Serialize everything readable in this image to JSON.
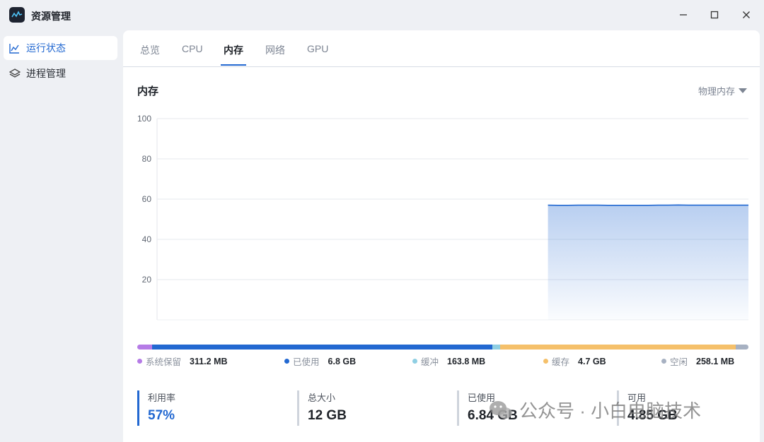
{
  "window": {
    "title": "资源管理"
  },
  "sidebar": {
    "items": [
      {
        "label": "运行状态",
        "icon": "line-chart-icon",
        "active": true
      },
      {
        "label": "进程管理",
        "icon": "layers-icon",
        "active": false
      }
    ]
  },
  "tabs": [
    {
      "label": "总览",
      "active": false
    },
    {
      "label": "CPU",
      "active": false
    },
    {
      "label": "内存",
      "active": true
    },
    {
      "label": "网络",
      "active": false
    },
    {
      "label": "GPU",
      "active": false
    }
  ],
  "section": {
    "title": "内存",
    "dropdown": "物理内存"
  },
  "chart_data": {
    "type": "area",
    "y_ticks": [
      "100",
      "80",
      "60",
      "40",
      "20"
    ],
    "ylim": [
      0,
      100
    ],
    "grid": true,
    "x": [
      0,
      1,
      2,
      3,
      4,
      5,
      6,
      7,
      8,
      9,
      10,
      11,
      12,
      13,
      14,
      15,
      16,
      17,
      18,
      19,
      20,
      21,
      22,
      23,
      24,
      25,
      26,
      27,
      28,
      29,
      30,
      31,
      32,
      33,
      34,
      35,
      36,
      37,
      38,
      39,
      40,
      41,
      42,
      43,
      44,
      45,
      46,
      47,
      48,
      49,
      50,
      51,
      52,
      53,
      54,
      55,
      56,
      57,
      58,
      59
    ],
    "values": [
      null,
      null,
      null,
      null,
      null,
      null,
      null,
      null,
      null,
      null,
      null,
      null,
      null,
      null,
      null,
      null,
      null,
      null,
      null,
      null,
      null,
      null,
      null,
      null,
      null,
      null,
      null,
      null,
      null,
      null,
      null,
      null,
      null,
      null,
      null,
      null,
      null,
      null,
      null,
      57.0,
      56.9,
      56.9,
      57.0,
      57.0,
      57.0,
      56.9,
      56.9,
      56.9,
      56.9,
      56.9,
      57.0,
      57.0,
      57.1,
      57.0,
      57.0,
      57.0,
      57.0,
      57.0,
      57.0,
      57.0
    ],
    "color": "#2268d1"
  },
  "memory_bar": [
    {
      "name": "系统保留",
      "value": "311.2 MB",
      "fraction": 0.024,
      "color": "#b57be6"
    },
    {
      "name": "已使用",
      "value": "6.8 GB",
      "fraction": 0.557,
      "color": "#2268d1"
    },
    {
      "name": "缓冲",
      "value": "163.8 MB",
      "fraction": 0.013,
      "color": "#8fcfe3"
    },
    {
      "name": "缓存",
      "value": "4.7 GB",
      "fraction": 0.385,
      "color": "#f5c06a"
    },
    {
      "name": "空闲",
      "value": "258.1 MB",
      "fraction": 0.021,
      "color": "#a7b1c2"
    }
  ],
  "stats": [
    {
      "label": "利用率",
      "value": "57%"
    },
    {
      "label": "总大小",
      "value": "12 GB"
    },
    {
      "label": "已使用",
      "value": "6.84 GB"
    },
    {
      "label": "可用",
      "value": "4.85 GB"
    }
  ],
  "watermark": {
    "text": "公众号 · 小白电脑技术"
  }
}
